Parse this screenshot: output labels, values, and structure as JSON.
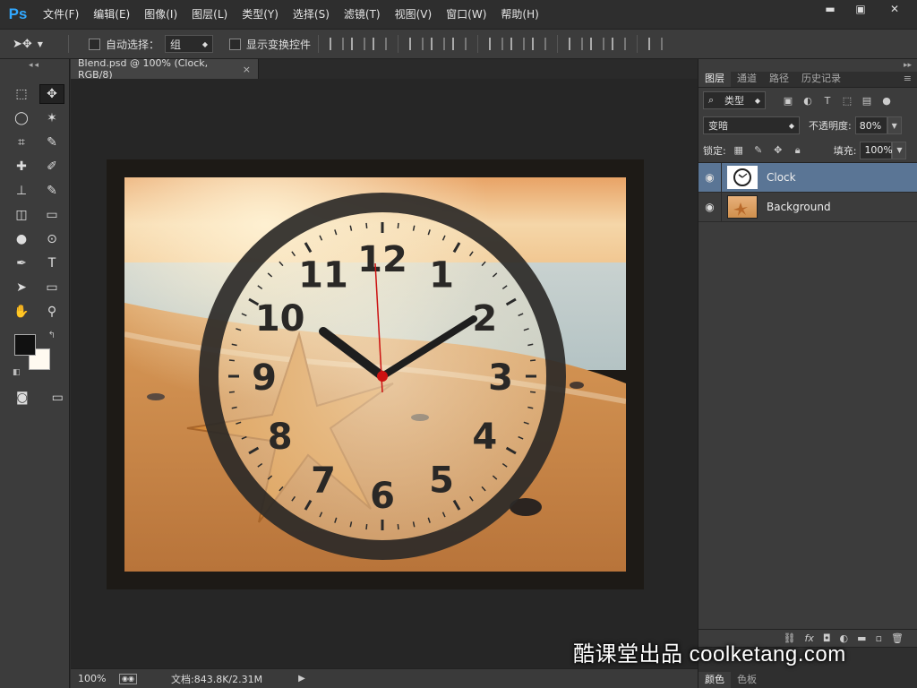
{
  "app": {
    "logo": "Ps"
  },
  "menu": [
    "文件(F)",
    "编辑(E)",
    "图像(I)",
    "图层(L)",
    "类型(Y)",
    "选择(S)",
    "滤镜(T)",
    "视图(V)",
    "窗口(W)",
    "帮助(H)"
  ],
  "window_controls": {
    "minimize": "▬",
    "maximize": "▣",
    "close": "✕"
  },
  "options": {
    "auto_select_label": "自动选择：",
    "auto_select_target": "组",
    "show_transform_label": "显示变换控件"
  },
  "tools": {
    "rows": [
      [
        "marquee-icon",
        "move-icon"
      ],
      [
        "lasso-icon",
        "magic-wand-icon"
      ],
      [
        "crop-icon",
        "eyedropper-icon"
      ],
      [
        "healing-icon",
        "brush-icon"
      ],
      [
        "stamp-icon",
        "history-brush-icon"
      ],
      [
        "eraser-icon",
        "gradient-icon"
      ],
      [
        "blur-icon",
        "dodge-icon"
      ],
      [
        "pen-icon",
        "type-icon"
      ],
      [
        "path-select-icon",
        "rectangle-icon"
      ],
      [
        "hand-icon",
        "zoom-icon"
      ]
    ],
    "glyphs": [
      "⬚",
      "✥",
      "◯",
      "✶",
      "⌗",
      "✎",
      "✚",
      "✐",
      "⊥",
      "✎",
      "◫",
      "▭",
      "●",
      "⊙",
      "✒",
      "T",
      "➤",
      "▭",
      "✋",
      "⚲"
    ],
    "foreground_color": "#111111",
    "background_color": "#fffaf0"
  },
  "document": {
    "tab_title": "Blend.psd @ 100% (Clock, RGB/8)",
    "close_glyph": "×"
  },
  "status": {
    "zoom": "100%",
    "doc_size": "文档:843.8K/2.31M"
  },
  "panel": {
    "tabs": [
      "图层",
      "通道",
      "路径",
      "历史记录"
    ],
    "filter_kind": "类型",
    "blend_mode": "变暗",
    "opacity_label": "不透明度:",
    "opacity_value": "80%",
    "lock_label": "锁定:",
    "fill_label": "填充:",
    "fill_value": "100%",
    "layers": [
      {
        "name": "Clock",
        "selected": true
      },
      {
        "name": "Background",
        "selected": false
      }
    ],
    "bottom_tabs": [
      "颜色",
      "色板"
    ]
  },
  "clock": {
    "numbers": [
      "12",
      "1",
      "2",
      "3",
      "4",
      "5",
      "6",
      "7",
      "8",
      "9",
      "10",
      "11"
    ]
  },
  "watermark": "酷课堂出品 coolketang.com",
  "colors": {
    "selection": "#5a7595",
    "ps_blue": "#31a8ff",
    "second_hand": "#cc1111"
  }
}
